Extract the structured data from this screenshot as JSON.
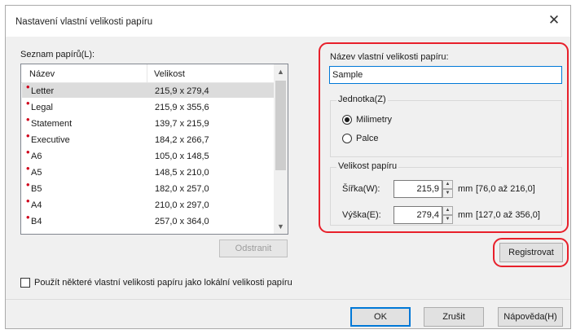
{
  "window": {
    "title": "Nastavení vlastní velikosti papíru",
    "close_glyph": "✕"
  },
  "paper_list": {
    "label": "Seznam papírů(L):",
    "columns": {
      "name": "Název",
      "size": "Velikost"
    },
    "rows": [
      {
        "name": "Letter",
        "size": "215,9 x 279,4"
      },
      {
        "name": "Legal",
        "size": "215,9 x 355,6"
      },
      {
        "name": "Statement",
        "size": "139,7 x 215,9"
      },
      {
        "name": "Executive",
        "size": "184,2 x 266,7"
      },
      {
        "name": "A6",
        "size": "105,0 x 148,5"
      },
      {
        "name": "A5",
        "size": "148,5 x 210,0"
      },
      {
        "name": "B5",
        "size": "182,0 x 257,0"
      },
      {
        "name": "A4",
        "size": "210,0 x 297,0"
      },
      {
        "name": "B4",
        "size": "257,0 x 364,0"
      }
    ],
    "delete_label": "Odstranit"
  },
  "custom_name": {
    "label": "Název vlastní velikosti papíru:",
    "value": "Sample"
  },
  "unit": {
    "label": "Jednotka(Z)",
    "options": [
      "Milimetry",
      "Palce"
    ],
    "selected": "Milimetry"
  },
  "paper_size": {
    "label": "Velikost papíru",
    "width_label": "Šířka(W):",
    "width_value": "215,9",
    "width_unit": "mm",
    "width_range": "[76,0 až 216,0]",
    "height_label": "Výška(E):",
    "height_value": "279,4",
    "height_unit": "mm",
    "height_range": "[127,0 až 356,0]"
  },
  "register_label": "Registrovat",
  "local_checkbox_label": "Použít některé vlastní velikosti papíru jako lokální velikosti papíru",
  "buttons": {
    "ok": "OK",
    "cancel": "Zrušit",
    "help": "Nápověda(H)"
  },
  "colors": {
    "highlight": "#e8202b",
    "accent": "#0078d7",
    "list_dot": "#d0021b"
  }
}
